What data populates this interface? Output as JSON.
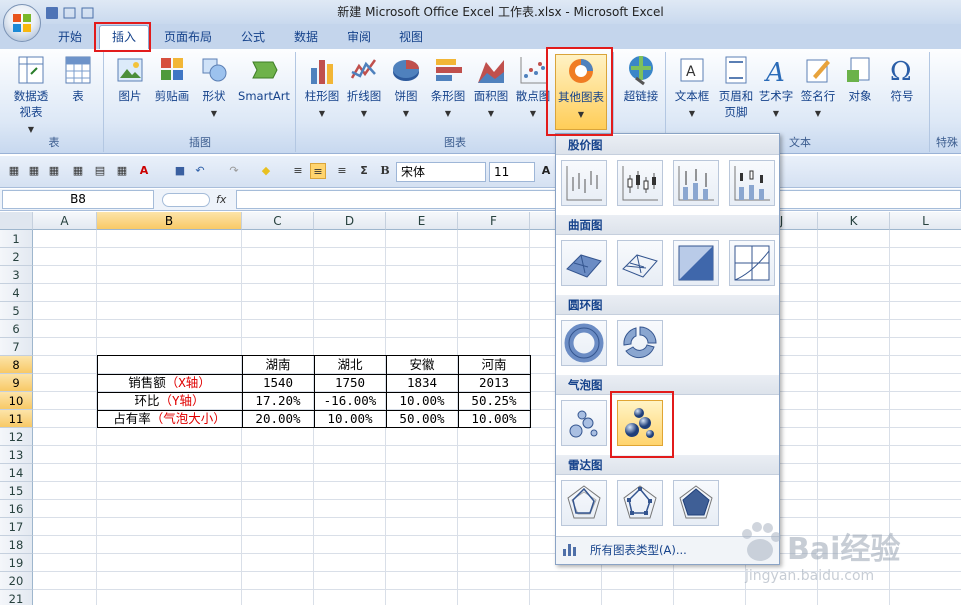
{
  "window": {
    "title": "新建 Microsoft Office Excel 工作表.xlsx - Microsoft Excel"
  },
  "ribbon_tabs": [
    "开始",
    "插入",
    "页面布局",
    "公式",
    "数据",
    "审阅",
    "视图"
  ],
  "ribbon": {
    "table_group": {
      "label": "表",
      "buttons": [
        "数据透视表",
        "表"
      ]
    },
    "illus_group": {
      "label": "插图",
      "buttons": [
        "图片",
        "剪贴画",
        "形状",
        "SmartArt"
      ]
    },
    "chart_group": {
      "label": "图表",
      "buttons": [
        "柱形图",
        "折线图",
        "饼图",
        "条形图",
        "面积图",
        "散点图",
        "其他图表"
      ]
    },
    "link": {
      "label": "超链接"
    },
    "text_group": {
      "label": "文本",
      "buttons": [
        "文本框",
        "页眉和页脚",
        "艺术字",
        "签名行",
        "对象",
        "符号"
      ]
    },
    "special_group": {
      "label": "特殊"
    }
  },
  "toolbar": {
    "font_name": "宋体",
    "font_size": "11"
  },
  "formula_bar": {
    "name_box": "B8",
    "fx": "fx",
    "value": ""
  },
  "columns": [
    "A",
    "B",
    "C",
    "D",
    "E",
    "F",
    "G",
    "H",
    "I",
    "J",
    "K",
    "L"
  ],
  "rows": [
    "1",
    "2",
    "3",
    "4",
    "5",
    "6",
    "7",
    "8",
    "9",
    "10",
    "11",
    "12",
    "13",
    "14",
    "15",
    "16",
    "17",
    "18",
    "19",
    "20",
    "21"
  ],
  "table": {
    "headers": [
      "湖南",
      "湖北",
      "安徽",
      "河南"
    ],
    "rows": [
      {
        "label": "销售额",
        "label_note": "（X轴）",
        "values": [
          "1540",
          "1750",
          "1834",
          "2013"
        ]
      },
      {
        "label": "环比",
        "label_note": "（Y轴）",
        "values": [
          "17.20%",
          "-16.00%",
          "10.00%",
          "50.25%"
        ]
      },
      {
        "label": "占有率",
        "label_note": "（气泡大小）",
        "values": [
          "20.00%",
          "10.00%",
          "50.00%",
          "10.00%"
        ]
      }
    ]
  },
  "dropdown": {
    "categories": [
      "股价图",
      "曲面图",
      "圆环图",
      "气泡图",
      "雷达图"
    ],
    "all_charts": "所有图表类型(A)..."
  },
  "watermark": {
    "brand": "Bai经验",
    "url": "jingyan.baidu.com"
  }
}
